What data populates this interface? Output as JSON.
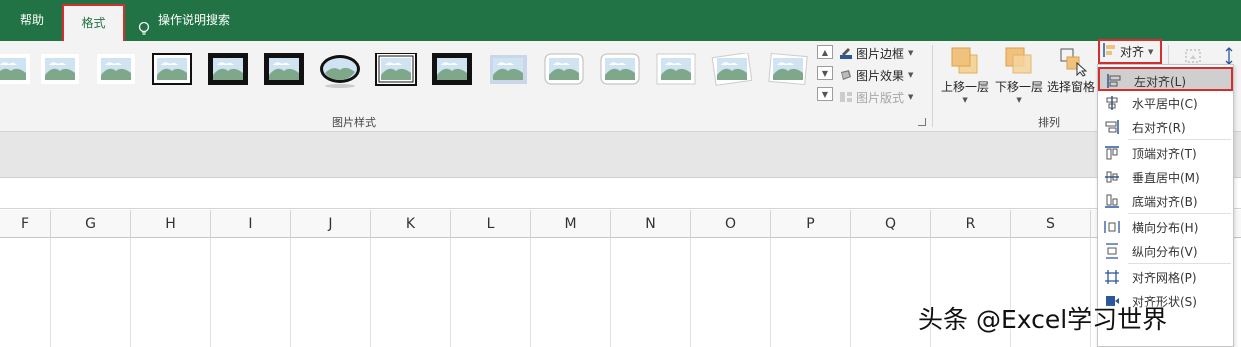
{
  "tabs": {
    "help": "帮助",
    "format": "格式",
    "search": "操作说明搜索"
  },
  "picture_styles": {
    "group_label": "图片样式",
    "border": "图片边框",
    "effects": "图片效果",
    "layout": "图片版式"
  },
  "arrange": {
    "group_label": "排列",
    "bring_forward": "上移一层",
    "send_backward": "下移一层",
    "selection_pane": "选择窗格",
    "align": "对齐"
  },
  "align_menu": [
    {
      "label": "左对齐(L)",
      "icon": "align-left-icon"
    },
    {
      "label": "水平居中(C)",
      "icon": "align-center-icon"
    },
    {
      "label": "右对齐(R)",
      "icon": "align-right-icon"
    },
    {
      "label": "顶端对齐(T)",
      "icon": "align-top-icon"
    },
    {
      "label": "垂直居中(M)",
      "icon": "align-middle-icon"
    },
    {
      "label": "底端对齐(B)",
      "icon": "align-bottom-icon"
    },
    {
      "label": "横向分布(H)",
      "icon": "distribute-horizontal-icon"
    },
    {
      "label": "纵向分布(V)",
      "icon": "distribute-vertical-icon"
    },
    {
      "label": "对齐网格(P)",
      "icon": "snap-grid-icon"
    },
    {
      "label": "对齐形状(S)",
      "icon": "snap-shape-icon"
    }
  ],
  "columns": [
    "F",
    "G",
    "H",
    "I",
    "J",
    "K",
    "L",
    "M",
    "N",
    "O",
    "P",
    "Q",
    "R",
    "S"
  ],
  "watermark": "头条 @Excel学习世界",
  "colors": {
    "excel_green": "#217346",
    "highlight_red": "#d32f2f",
    "active_item": "#cfcfcf"
  }
}
